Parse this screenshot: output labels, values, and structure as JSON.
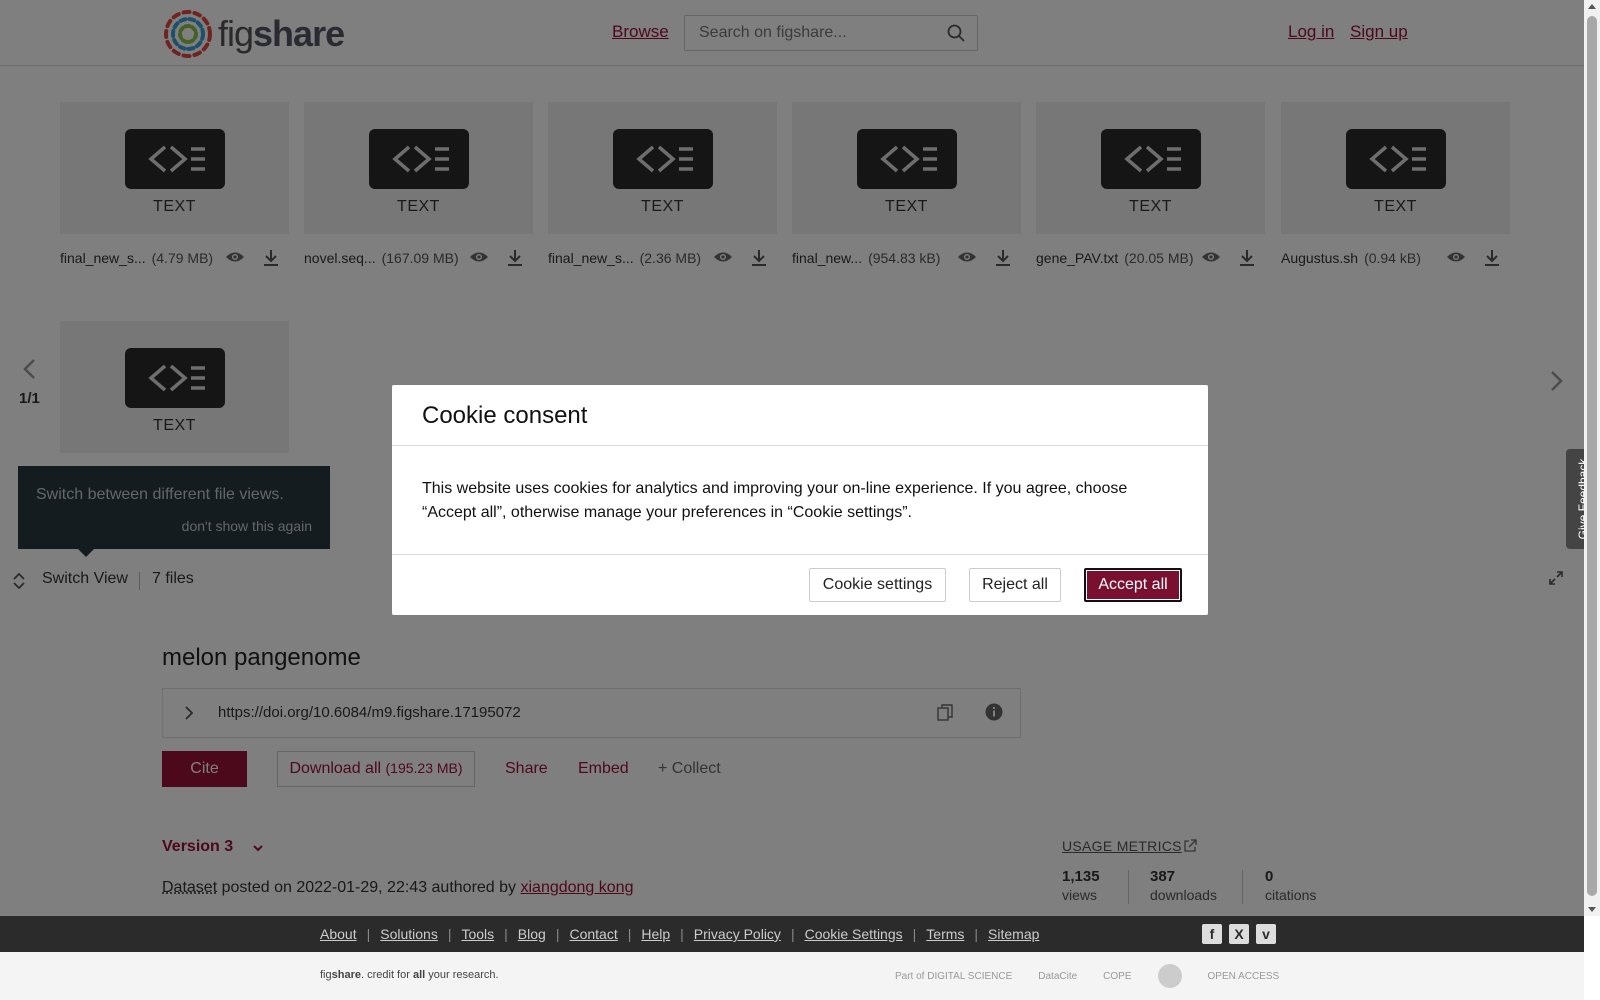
{
  "header": {
    "logo_text_light": "fig",
    "logo_text_bold": "share",
    "browse": "Browse",
    "search_placeholder": "Search on figshare...",
    "login": "Log in",
    "signup": "Sign up"
  },
  "viewer": {
    "tile_label": "TEXT",
    "files": [
      {
        "name": "final_new_s...",
        "size": "(4.79 MB)"
      },
      {
        "name": "novel.seq...",
        "size": "(167.09 MB)"
      },
      {
        "name": "final_new_s...",
        "size": "(2.36 MB)"
      },
      {
        "name": "final_new...",
        "size": "(954.83 kB)"
      },
      {
        "name": "gene_PAV.txt",
        "size": "(20.05 MB)"
      },
      {
        "name": "Augustus.sh",
        "size": "(0.94 kB)"
      }
    ],
    "page_count": "1/1",
    "tooltip_message": "Switch between different file views.",
    "tooltip_dismiss": "don't show this again",
    "switch_view": "Switch View",
    "file_count": "7 files"
  },
  "item": {
    "title": "melon pangenome",
    "doi": "https://doi.org/10.6084/m9.figshare.17195072",
    "cite": "Cite",
    "download_all": "Download all",
    "download_size": "(195.23 MB)",
    "share": "Share",
    "embed": "Embed",
    "collect": "+ Collect",
    "version": "Version 3",
    "type": "Dataset",
    "posted_text": " posted on 2022-01-29, 22:43 authored by ",
    "author": "xiangdong kong",
    "usage_metrics": "USAGE METRICS",
    "metrics": [
      {
        "value": "1,135",
        "label": "views"
      },
      {
        "value": "387",
        "label": "downloads"
      },
      {
        "value": "0",
        "label": "citations"
      }
    ]
  },
  "cookie": {
    "title": "Cookie consent",
    "body": "This website uses cookies for analytics and improving your on-line experience. If you agree, choose “Accept all”, otherwise manage your preferences in “Cookie settings”.",
    "settings": "Cookie settings",
    "reject": "Reject all",
    "accept": "Accept all"
  },
  "feedback": "Give Feedback",
  "footer": {
    "links": [
      "About",
      "Solutions",
      "Tools",
      "Blog",
      "Contact",
      "Help",
      "Privacy Policy",
      "Cookie Settings",
      "Terms",
      "Sitemap"
    ],
    "tagline_brand_light": "fig",
    "tagline_brand_bold": "share",
    "tagline_rest_1": ". credit for ",
    "tagline_all": "all",
    "tagline_rest_2": " your research.",
    "partners": [
      "Part of DIGITAL SCIENCE",
      "DataCite",
      "COPE",
      "",
      "OPEN ACCESS"
    ]
  },
  "colors": {
    "brand": "#9b1238",
    "accept_button": "#7a1030",
    "footer_dark": "#2b2b2b",
    "tile_badge": "#2b2b2b"
  }
}
